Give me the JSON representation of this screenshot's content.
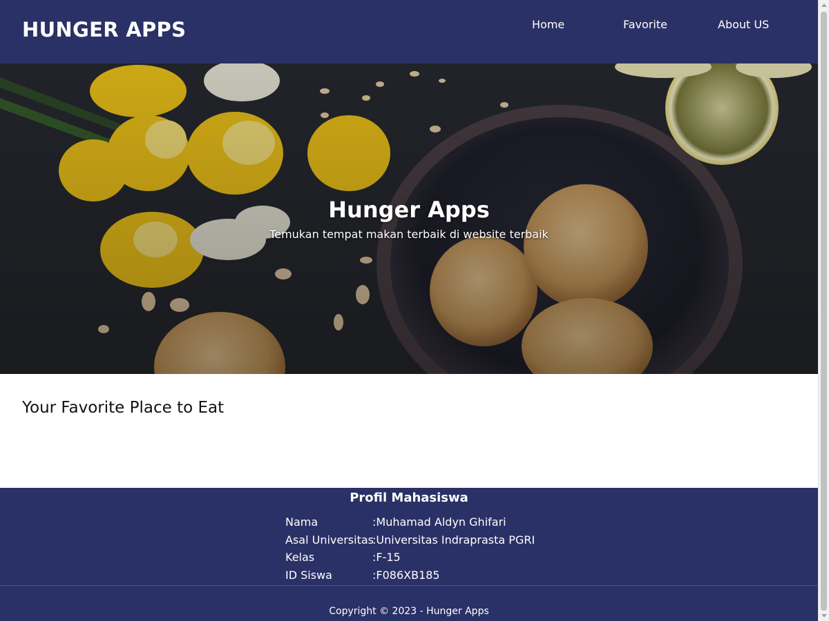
{
  "header": {
    "brand": "HUNGER APPS",
    "nav": [
      {
        "label": "Home"
      },
      {
        "label": "Favorite"
      },
      {
        "label": "About US"
      }
    ]
  },
  "hero": {
    "title": "Hunger Apps",
    "subtitle": "Temukan tempat makan terbaik di website terbaik"
  },
  "main": {
    "title": "Your Favorite Place to Eat"
  },
  "footer": {
    "profile_title": "Profil Mahasiswa",
    "profile": [
      {
        "label": "Nama",
        "value": ":Muhamad Aldyn Ghifari"
      },
      {
        "label": "Asal Universitas",
        "value": ":Universitas Indraprasta PGRI"
      },
      {
        "label": "Kelas",
        "value": ":F-15"
      },
      {
        "label": "ID Siswa",
        "value": ":F086XB185"
      }
    ],
    "copyright": "Copyright © 2023 - Hunger Apps"
  },
  "colors": {
    "navbar": "#2a3166",
    "footer": "#2a3166",
    "text_light": "#ffffff"
  }
}
